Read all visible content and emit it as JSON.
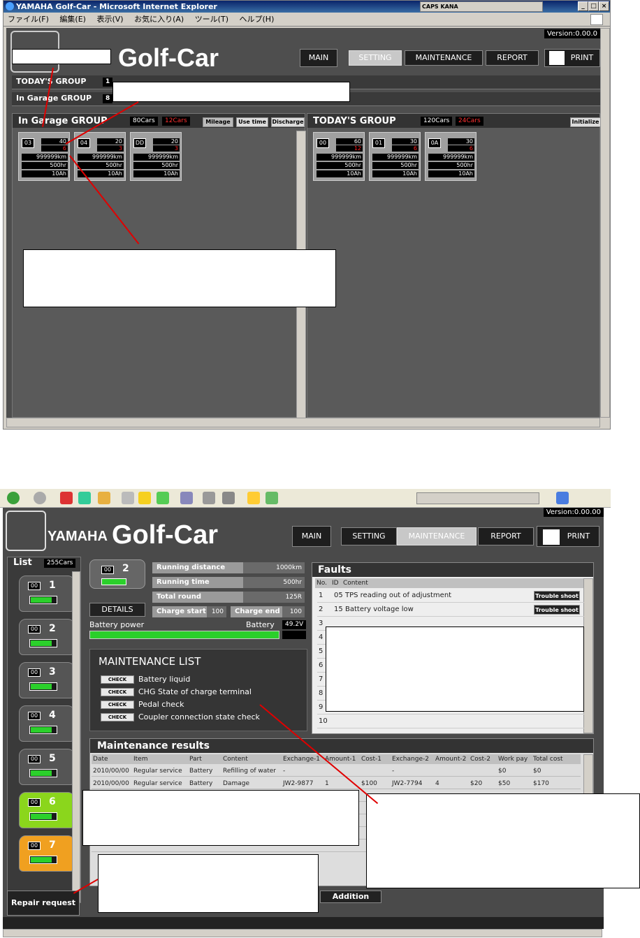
{
  "top": {
    "window_title": "YAMAHA Golf-Car - Microsoft Internet Explorer",
    "menu": [
      "ファイル(F)",
      "編集(E)",
      "表示(V)",
      "お気に入り(A)",
      "ツール(T)",
      "ヘルプ(H)"
    ],
    "tray_text": "CAPS KANA",
    "version": "Version:0.00.0",
    "logo": "Golf-Car",
    "nav": {
      "main": "MAIN",
      "setting": "SETTING",
      "maintenance": "MAINTENANCE",
      "report": "REPORT",
      "print": "PRINT"
    },
    "todays_group_label": "TODAY'S GROUP",
    "todays_group_value": "1",
    "in_garage_group_label": "In Garage GROUP",
    "in_garage_group_value": "8",
    "left_panel": {
      "title": "In Garage GROUP",
      "cars": "80Cars",
      "cars_red": "12Cars",
      "buttons": {
        "mileage": "Mileage",
        "use_time": "Use time",
        "discharge": "Discharge"
      },
      "cards": [
        {
          "id": "03",
          "a": "40",
          "b": "6",
          "km": "999999km",
          "hr": "500hr",
          "ah": "10Ah"
        },
        {
          "id": "04",
          "a": "20",
          "b": "3",
          "km": "999999km",
          "hr": "500hr",
          "ah": "10Ah"
        },
        {
          "id": "DD",
          "a": "20",
          "b": "3",
          "km": "999999km",
          "hr": "500hr",
          "ah": "10Ah"
        }
      ]
    },
    "right_panel": {
      "title": "TODAY'S GROUP",
      "cars": "120Cars",
      "cars_red": "24Cars",
      "initialize": "Initialize",
      "cards": [
        {
          "id": "00",
          "a": "60",
          "b": "12",
          "km": "999999km",
          "hr": "500hr",
          "ah": "10Ah"
        },
        {
          "id": "01",
          "a": "30",
          "b": "6",
          "km": "999999km",
          "hr": "500hr",
          "ah": "10Ah"
        },
        {
          "id": "0A",
          "a": "30",
          "b": "6",
          "km": "999999km",
          "hr": "500hr",
          "ah": "10Ah"
        }
      ]
    }
  },
  "bottom": {
    "version": "Version:0.00.00",
    "logo_brand": "YAMAHA",
    "logo": "Golf-Car",
    "nav": {
      "main": "MAIN",
      "setting": "SETTING",
      "maintenance": "MAINTENANCE",
      "report": "REPORT",
      "print": "PRINT"
    },
    "list_title": "List",
    "list_count": "255Cars",
    "list_cars": [
      {
        "id": "00",
        "n": "1",
        "color": "#555555"
      },
      {
        "id": "00",
        "n": "2",
        "color": "#555555"
      },
      {
        "id": "00",
        "n": "3",
        "color": "#555555"
      },
      {
        "id": "00",
        "n": "4",
        "color": "#555555"
      },
      {
        "id": "00",
        "n": "5",
        "color": "#555555"
      },
      {
        "id": "00",
        "n": "6",
        "color": "#8bd61c"
      },
      {
        "id": "00",
        "n": "7",
        "color": "#f0a020"
      }
    ],
    "repair_request": "Repair request",
    "car_detail": {
      "id": "00",
      "n": "2",
      "running_distance_label": "Running distance",
      "running_distance": "1000km",
      "running_time_label": "Running time",
      "running_time": "500hr",
      "total_round_label": "Total round",
      "total_round": "125R",
      "charge_start_label": "Charge start",
      "charge_start": "100",
      "charge_end_label": "Charge end",
      "charge_end": "100",
      "details": "DETAILS",
      "battery_power": "Battery power",
      "battery_label": "Battery",
      "battery_value": "49.2V"
    },
    "maintenance_list": {
      "title": "MAINTENANCE LIST",
      "check": "CHECK",
      "items": [
        "Battery liquid",
        "CHG State of charge terminal",
        "Pedal check",
        "Coupler connection state check"
      ]
    },
    "faults": {
      "title": "Faults",
      "headers": [
        "No.",
        "ID",
        "Content"
      ],
      "rows": [
        {
          "no": "1",
          "id": "05",
          "content": "TPS reading out of adjustment",
          "btn": "Trouble shoot"
        },
        {
          "no": "2",
          "id": "15",
          "content": "Battery voltage low",
          "btn": "Trouble shoot"
        },
        {
          "no": "3",
          "id": "",
          "content": "",
          "btn": ""
        },
        {
          "no": "4",
          "id": "",
          "content": "",
          "btn": ""
        },
        {
          "no": "5",
          "id": "",
          "content": "",
          "btn": ""
        },
        {
          "no": "6",
          "id": "",
          "content": "",
          "btn": ""
        },
        {
          "no": "7",
          "id": "",
          "content": "",
          "btn": ""
        },
        {
          "no": "8",
          "id": "",
          "content": "",
          "btn": ""
        },
        {
          "no": "9",
          "id": "",
          "content": "",
          "btn": ""
        },
        {
          "no": "10",
          "id": "",
          "content": "",
          "btn": ""
        }
      ]
    },
    "results": {
      "title": "Maintenance results",
      "headers": [
        "Date",
        "Item",
        "Part",
        "Content",
        "Exchange-1",
        "Amount-1",
        "Cost-1",
        "Exchange-2",
        "Amount-2",
        "Cost-2",
        "Work pay",
        "Total cost"
      ],
      "rows": [
        [
          "2010/00/00",
          "Regular service",
          "Battery",
          "Refilling of water",
          "-",
          "",
          "",
          "-",
          "",
          "",
          "$0",
          "$0"
        ],
        [
          "2010/00/00",
          "Regular service",
          "Battery",
          "Damage",
          "JW2-9877",
          "1",
          "$100",
          "JW2-7794",
          "4",
          "$20",
          "$50",
          "$170"
        ]
      ]
    },
    "addition": "Addition"
  },
  "colors": {
    "accent_red": "#e00000",
    "battery_green": "#2bd02b"
  }
}
